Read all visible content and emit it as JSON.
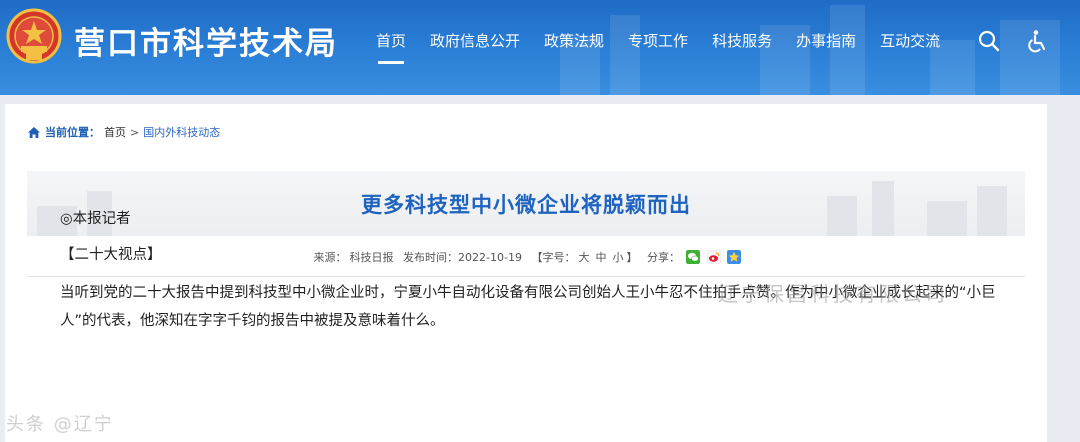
{
  "header": {
    "site_title": "营口市科学技术局",
    "nav": [
      "首页",
      "政府信息公开",
      "政策法规",
      "专项工作",
      "科技服务",
      "办事指南",
      "互动交流"
    ],
    "active_index": 0,
    "icons": [
      "search-icon",
      "accessibility-icon"
    ]
  },
  "breadcrumb": {
    "label": "当前位置：",
    "home": "首页",
    "separator": ">",
    "current": "国内外科技动态"
  },
  "article": {
    "title": "更多科技型中小微企业将脱颖而出",
    "source_label": "来源：",
    "source": "科技日报",
    "date_label": "发布时间：",
    "date": "2022-10-19",
    "font_open": "【字号：",
    "font_large": "大",
    "font_medium": "中",
    "font_small": "小",
    "font_close": "】",
    "share_label": "分享：",
    "share_icons": [
      "wechat-icon",
      "weibo-icon",
      "qzone-icon"
    ],
    "paragraphs": [
      "◎本报记者",
      "【二十大视点】",
      "当听到党的二十大报告中提到科技型中小微企业时，宁夏小牛自动化设备有限公司创始人王小牛忍不住拍手点赞。作为中小微企业成长起来的“小巨人”的代表，他深知在字字千钧的报告中被提及意味着什么。"
    ]
  },
  "watermarks": {
    "right": "辽宁保昌科技有限公司",
    "left": "头条 @辽宁"
  },
  "colors": {
    "header_blue": "#2b7fd6",
    "title_blue": "#1e63bf",
    "link_blue": "#2c66c4"
  }
}
